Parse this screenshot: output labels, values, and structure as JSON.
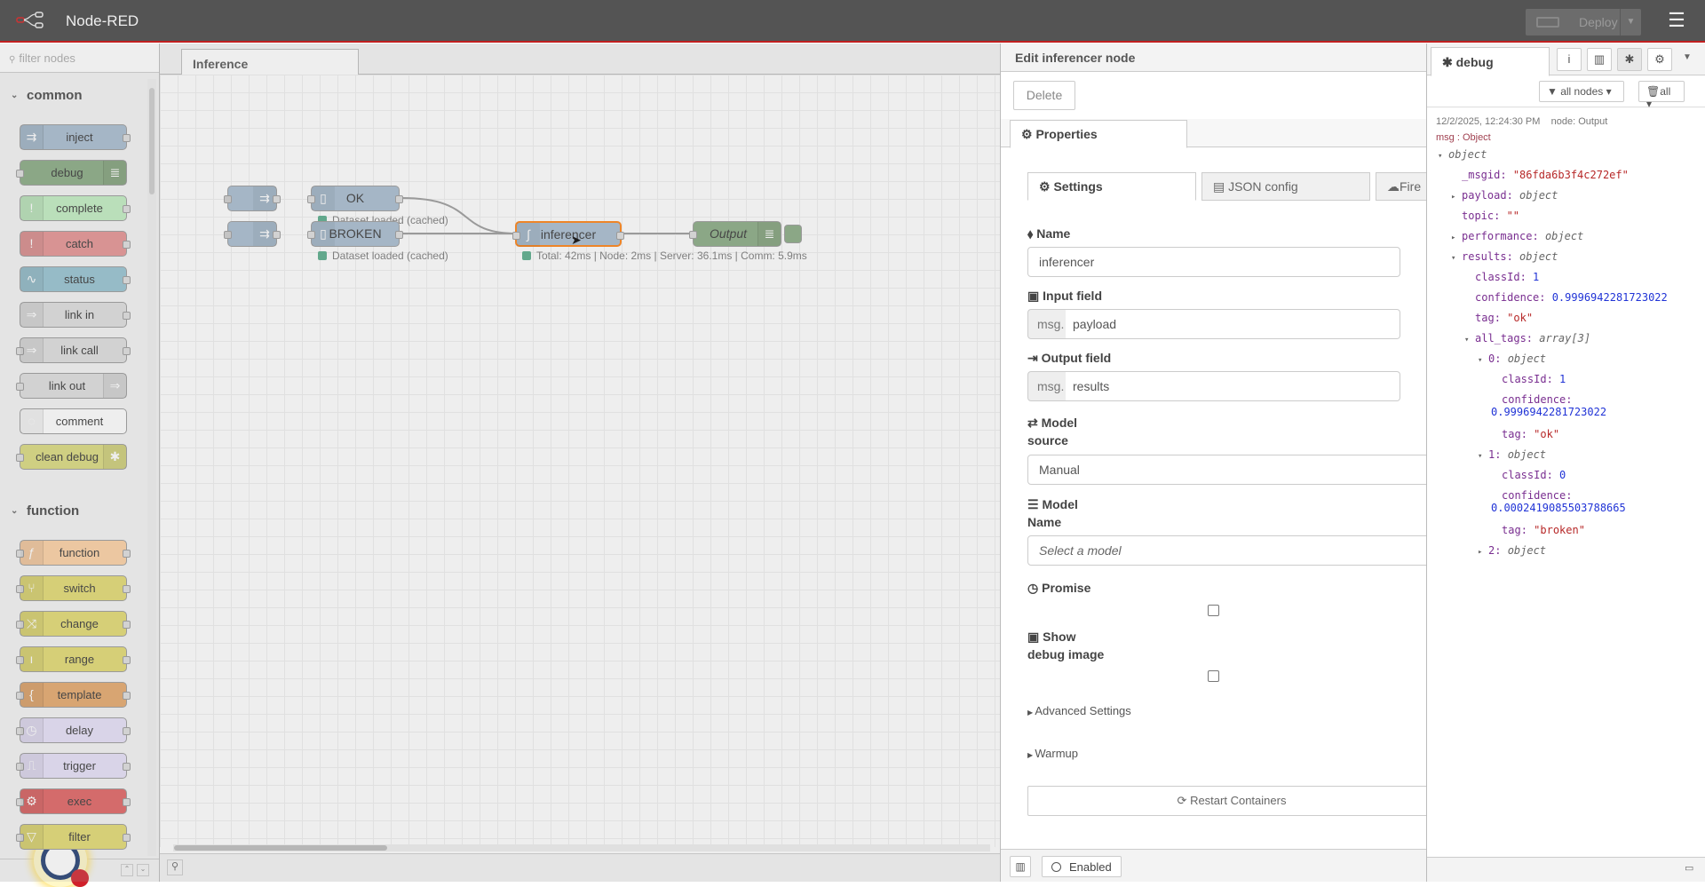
{
  "header": {
    "title": "Node-RED",
    "deploy_label": "Deploy",
    "menu_icon": "hamburger-icon"
  },
  "palette": {
    "filter_placeholder": "filter nodes",
    "categories": [
      {
        "name": "common",
        "nodes": [
          {
            "label": "inject",
            "color": "#a6bbcf"
          },
          {
            "label": "debug",
            "color": "#87a980"
          },
          {
            "label": "complete",
            "color": "#c0edc0"
          },
          {
            "label": "catch",
            "color": "#e49191"
          },
          {
            "label": "status",
            "color": "#94c1d0"
          },
          {
            "label": "link in",
            "color": "#dddddd"
          },
          {
            "label": "link call",
            "color": "#dddddd"
          },
          {
            "label": "link out",
            "color": "#dddddd"
          },
          {
            "label": "comment",
            "color": "#ffffff"
          },
          {
            "label": "clean debug",
            "color": "#d9d97c"
          }
        ]
      },
      {
        "name": "function",
        "nodes": [
          {
            "label": "function",
            "color": "#fdd0a2"
          },
          {
            "label": "switch",
            "color": "#e2d96e"
          },
          {
            "label": "change",
            "color": "#e2d96e"
          },
          {
            "label": "range",
            "color": "#e2d96e"
          },
          {
            "label": "template",
            "color": "#e5a668"
          },
          {
            "label": "delay",
            "color": "#e6e0f8"
          },
          {
            "label": "trigger",
            "color": "#e6e0f8"
          },
          {
            "label": "exec",
            "color": "#e06060"
          },
          {
            "label": "filter",
            "color": "#e2d96e"
          }
        ]
      }
    ]
  },
  "workspace": {
    "tab": "Inference",
    "nodes": {
      "ok": "OK",
      "broken": "BROKEN",
      "inferencer": "inferencer",
      "output": "Output"
    },
    "status": {
      "ok": "Dataset loaded (cached)",
      "broken": "Dataset loaded (cached)",
      "inferencer": "Total: 42ms | Node: 2ms | Server: 36.1ms | Comm: 5.9ms"
    }
  },
  "tray": {
    "title": "Edit inferencer node",
    "delete_label": "Delete",
    "properties_tab": "Properties",
    "subtabs": [
      "Settings",
      "JSON config",
      "Fire"
    ],
    "fields": {
      "name_label": "Name",
      "name_value": "inferencer",
      "input_label": "Input field",
      "input_prefix": "msg.",
      "input_value": "payload",
      "output_label": "Output field",
      "output_prefix": "msg.",
      "output_value": "results",
      "source_label_1": "Model",
      "source_label_2": "source",
      "source_value": "Manual",
      "model_label_1": "Model",
      "model_label_2": "Name",
      "model_placeholder": "Select a model",
      "promise_label": "Promise",
      "show_label_1": "Show",
      "show_label_2": "debug image"
    },
    "advanced_label": "Advanced Settings",
    "warmup_label": "Warmup",
    "restart_label": "Restart Containers",
    "enabled_label": "Enabled"
  },
  "sidebar": {
    "tab": "debug",
    "filter_label": "all nodes",
    "clear_label": "all",
    "message": {
      "timestamp": "12/2/2025, 12:24:30 PM",
      "node": "node: Output",
      "type": "msg : Object",
      "lines": [
        {
          "t": "v",
          "text": "object"
        },
        {
          "k": "_msgid",
          "v": "\"86fda6b3f4c272ef\"",
          "c": "s"
        },
        {
          "t": ">",
          "k": "payload",
          "v": "object",
          "c": "t"
        },
        {
          "k": "topic",
          "v": "\"\"",
          "c": "s"
        },
        {
          "t": ">",
          "k": "performance",
          "v": "object",
          "c": "t"
        },
        {
          "t": "v",
          "k": "results",
          "v": "object",
          "c": "t"
        },
        {
          "k": "classId",
          "v": "1",
          "c": "n"
        },
        {
          "k": "confidence",
          "v": "0.9996942281723022",
          "c": "n"
        },
        {
          "k": "tag",
          "v": "\"ok\"",
          "c": "s"
        },
        {
          "t": "v",
          "k": "all_tags",
          "v": "array[3]",
          "c": "t"
        },
        {
          "t": "v",
          "k": "0",
          "v": "object",
          "c": "t"
        },
        {
          "k": "classId",
          "v": "1",
          "c": "n"
        },
        {
          "k": "confidence",
          "v": "0.9996942281723022",
          "c": "n"
        },
        {
          "k": "tag",
          "v": "\"ok\"",
          "c": "s"
        },
        {
          "t": "v",
          "k": "1",
          "v": "object",
          "c": "t"
        },
        {
          "k": "classId",
          "v": "0",
          "c": "n"
        },
        {
          "k": "confidence",
          "v": "0.0002419085503788665",
          "c": "n"
        },
        {
          "k": "tag",
          "v": "\"broken\"",
          "c": "s"
        },
        {
          "t": ">",
          "k": "2",
          "v": "object",
          "c": "t"
        }
      ]
    }
  }
}
